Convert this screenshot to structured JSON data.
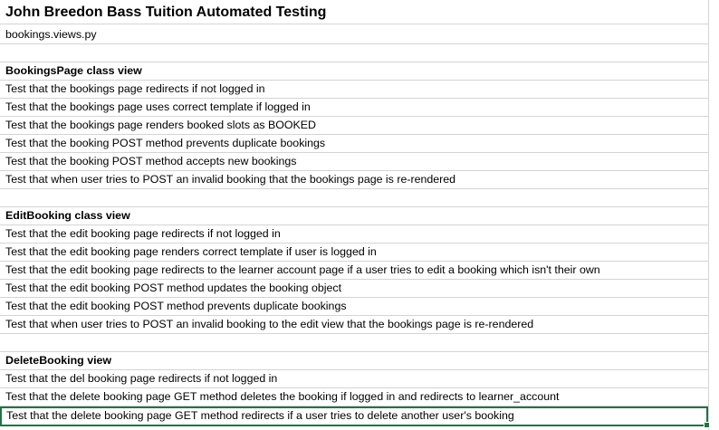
{
  "sheet": {
    "title": "John Breedon Bass Tuition Automated Testing",
    "subtitle": "bookings.views.py",
    "sections": [
      {
        "header": "BookingsPage class view",
        "tests": [
          "Test that the bookings page redirects if not logged in",
          "Test that the bookings page uses correct template if logged in",
          "Test that the bookings page renders booked slots as BOOKED",
          "Test that the booking POST method prevents duplicate bookings",
          "Test that the booking POST method accepts new bookings",
          "Test that when user tries to POST an invalid booking that the bookings page is re-rendered"
        ]
      },
      {
        "header": "EditBooking class view",
        "tests": [
          "Test that the edit booking page redirects if not logged in",
          "Test that the edit booking page renders correct template if user is logged in",
          "Test that the edit booking page redirects to the learner account page if a user tries to edit a booking which isn't their own",
          "Test that the edit booking POST method updates the booking object",
          "Test that the edit booking POST method prevents duplicate bookings",
          "Test that when user tries to POST an invalid booking to the edit view that the bookings page is re-rendered"
        ]
      },
      {
        "header": "DeleteBooking view",
        "tests": [
          "Test that the del booking page redirects if not logged in",
          "Test that the delete booking page GET method deletes the booking if logged in and redirects to learner_account",
          "Test that the delete booking page GET method redirects if a user tries to delete another user's booking"
        ]
      }
    ]
  },
  "colors": {
    "gridline": "#d4d4d4",
    "selection": "#217346"
  }
}
